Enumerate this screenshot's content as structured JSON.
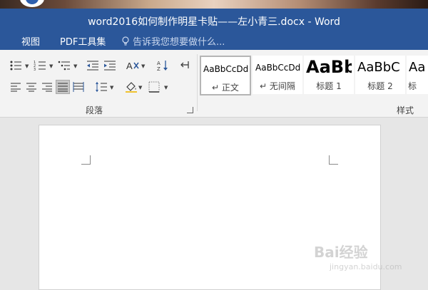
{
  "window": {
    "title": "word2016如何制作明星卡贴——左小青三.docx - Word"
  },
  "menubar": {
    "items": [
      {
        "label": "视图"
      },
      {
        "label": "PDF工具集"
      }
    ],
    "tell_me_placeholder": "告诉我您想要做什么..."
  },
  "ribbon": {
    "paragraph_group_label": "段落",
    "styles_group_label": "样式",
    "styles": [
      {
        "sample": "AaBbCcDd",
        "name": "正文",
        "selected": true
      },
      {
        "sample": "AaBbCcDd",
        "name": "无间隔",
        "selected": false
      },
      {
        "sample": "AaBb",
        "name": "标题 1",
        "selected": false
      },
      {
        "sample": "AaBbC",
        "name": "标题 2",
        "selected": false
      },
      {
        "sample": "Aa",
        "name": "标",
        "selected": false
      }
    ]
  },
  "watermark": {
    "brand": "Bai经验",
    "url": "jingyan.baidu.com"
  },
  "colors": {
    "titlebar": "#2b579a",
    "ribbon": "#f3f3f3",
    "canvas": "#e6e6e6"
  }
}
